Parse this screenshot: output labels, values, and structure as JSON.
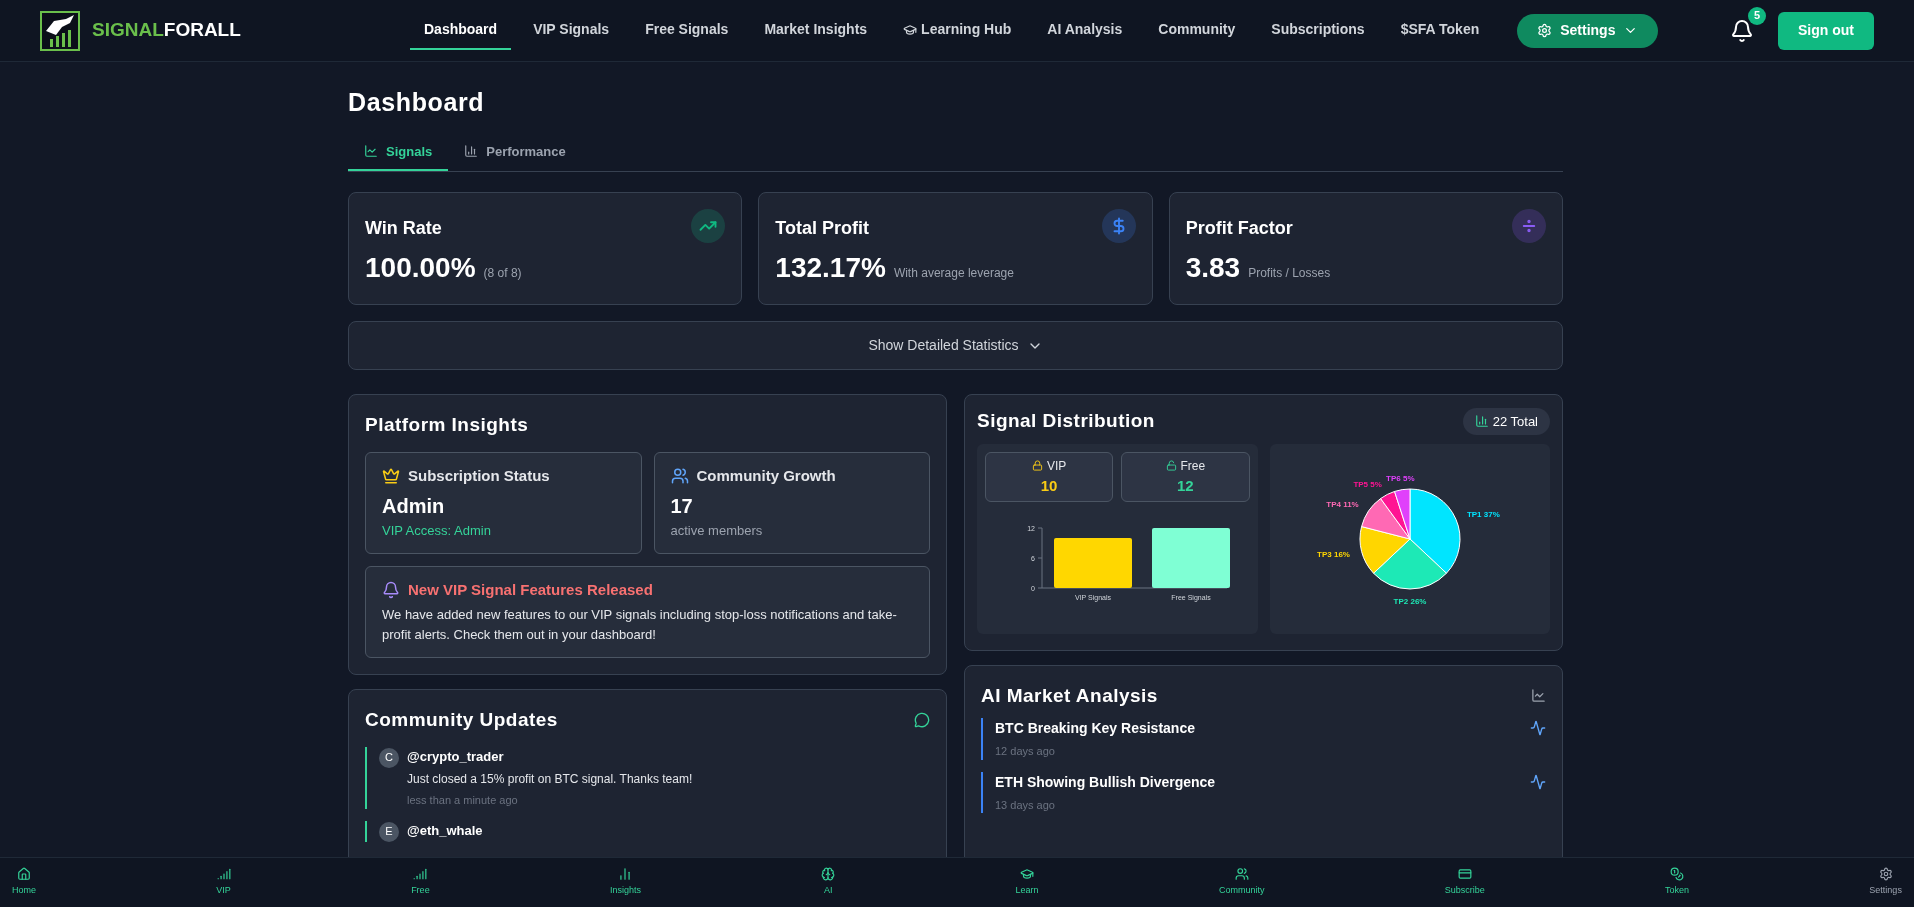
{
  "brand": {
    "part_1": "SIGNAL",
    "part_2": "FORALL"
  },
  "nav": [
    {
      "label": "Dashboard",
      "selected": true,
      "has_icon": false
    },
    {
      "label": "VIP Signals",
      "selected": false,
      "has_icon": false
    },
    {
      "label": "Free Signals",
      "selected": false,
      "has_icon": false
    },
    {
      "label": "Market Insights",
      "selected": false,
      "has_icon": false
    },
    {
      "label": "Learning Hub",
      "selected": false,
      "has_icon": true
    },
    {
      "label": "AI Analysis",
      "selected": false,
      "has_icon": false
    },
    {
      "label": "Community",
      "selected": false,
      "has_icon": false
    },
    {
      "label": "Subscriptions",
      "selected": false,
      "has_icon": false
    },
    {
      "label": "$SFA Token",
      "selected": false,
      "has_icon": false
    }
  ],
  "settings_button": "Settings",
  "notifications": {
    "count": "5"
  },
  "sign_out": "Sign out",
  "page_title": "Dashboard",
  "tabs": [
    {
      "label": "Signals",
      "selected": true
    },
    {
      "label": "Performance",
      "selected": false
    }
  ],
  "stats": [
    {
      "title": "Win Rate",
      "value": "100.00%",
      "note": "(8 of 8)",
      "color": "#10b981"
    },
    {
      "title": "Total Profit",
      "value": "132.17%",
      "note": "With average leverage",
      "color": "#3b82f6"
    },
    {
      "title": "Profit Factor",
      "value": "3.83",
      "note": "Profits / Losses",
      "color": "#8b5cf6"
    }
  ],
  "details_toggle": {
    "label": "Show Detailed Statistics",
    "expanded": false
  },
  "platform_insights": {
    "title": "Platform Insights",
    "subscription": {
      "title": "Subscription Status",
      "value": "Admin",
      "note": "VIP Access: Admin"
    },
    "community": {
      "title": "Community Growth",
      "value": "17",
      "note": "active members"
    },
    "announcement": {
      "title": "New VIP Signal Features Released",
      "body": "We have added new features to our VIP signals including stop-loss notifications and take-profit alerts. Check them out in your dashboard!"
    }
  },
  "community_updates": {
    "title": "Community Updates",
    "posts": [
      {
        "initial": "C",
        "user": "@crypto_trader",
        "text": "Just closed a 15% profit on BTC signal. Thanks team!",
        "time": "less than a minute ago"
      },
      {
        "initial": "E",
        "user": "@eth_whale"
      }
    ]
  },
  "signal_distribution": {
    "title": "Signal Distribution",
    "total": "22 Total",
    "vip": {
      "label": "VIP",
      "value": "10"
    },
    "free": {
      "label": "Free",
      "value": "12"
    },
    "bar_chart": {
      "chart_data": {
        "type": "bar",
        "categories": [
          "VIP Signals",
          "Free Signals"
        ],
        "yticks": [
          0,
          6,
          12
        ],
        "ylim": [
          0,
          12
        ],
        "values": [
          10,
          12
        ],
        "colors": [
          "#ffd700",
          "#7fffd4"
        ]
      }
    },
    "pie_chart": {
      "chart_data": {
        "type": "pie",
        "categories": [
          "TP1 37%",
          "TP2 26%",
          "TP3 16%",
          "TP4 11%",
          "TP5 5%",
          "TP6 5%"
        ],
        "values": [
          37,
          26,
          16,
          11,
          5,
          5
        ],
        "colors": [
          "#00e5ff",
          "#1de9b6",
          "#ffd600",
          "#ff69b4",
          "#ff1493",
          "#e040fb"
        ]
      }
    }
  },
  "ai_analysis": {
    "title": "AI Market Analysis",
    "items": [
      {
        "title": "BTC Breaking Key Resistance",
        "time": "12 days ago"
      },
      {
        "title": "ETH Showing Bullish Divergence",
        "time": "13 days ago"
      }
    ]
  },
  "bottom_nav": [
    {
      "label": "Home",
      "dimmed": false
    },
    {
      "label": "VIP",
      "dimmed": false
    },
    {
      "label": "Free",
      "dimmed": false
    },
    {
      "label": "Insights",
      "dimmed": false
    },
    {
      "label": "AI",
      "dimmed": false
    },
    {
      "label": "Learn",
      "dimmed": false
    },
    {
      "label": "Community",
      "dimmed": false
    },
    {
      "label": "Subscribe",
      "dimmed": false
    },
    {
      "label": "Token",
      "dimmed": false
    },
    {
      "label": "Settings",
      "dimmed": true
    }
  ]
}
